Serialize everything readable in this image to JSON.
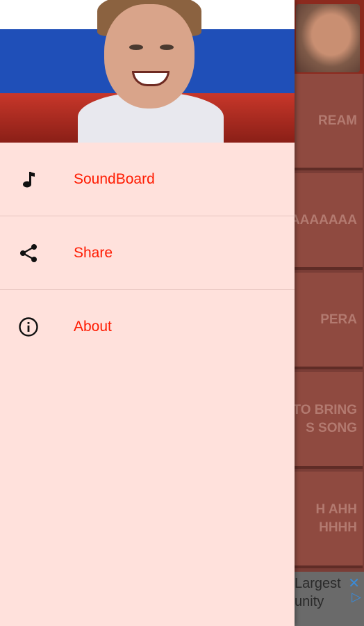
{
  "background_app": {
    "cards": [
      {
        "text_lines": [
          "REAM"
        ]
      },
      {
        "text_lines": [
          "AAAAAAA"
        ]
      },
      {
        "text_lines": [
          "PERA"
        ]
      },
      {
        "text_lines": [
          "TO BRING",
          "S SONG"
        ]
      },
      {
        "text_lines": [
          "H AHH",
          "HHHH"
        ]
      }
    ],
    "ad": {
      "text_line1": "Largest",
      "text_line2": "unity",
      "close_icon": "close-icon",
      "arrow_icon": "play-arrow-icon"
    }
  },
  "drawer": {
    "menu": [
      {
        "label": "SoundBoard",
        "icon": "music-note-icon"
      },
      {
        "label": "Share",
        "icon": "share-icon"
      },
      {
        "label": "About",
        "icon": "info-icon"
      }
    ],
    "label_color": "#ff1a00"
  }
}
